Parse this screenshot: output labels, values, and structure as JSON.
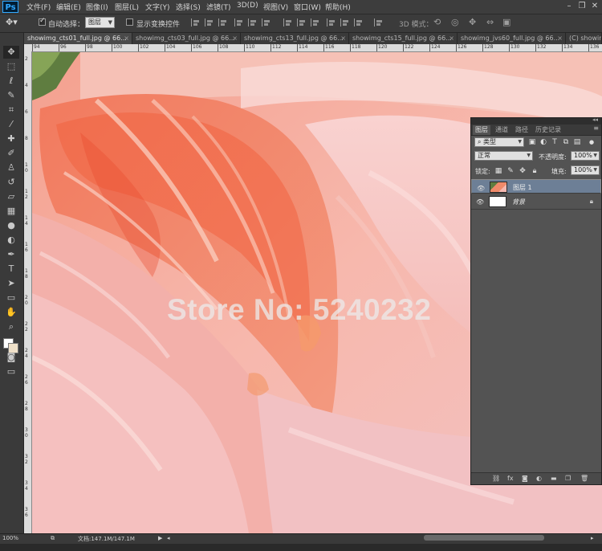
{
  "app": {
    "logo": "Ps"
  },
  "menu": [
    "文件(F)",
    "编辑(E)",
    "图像(I)",
    "图层(L)",
    "文字(Y)",
    "选择(S)",
    "滤镜(T)",
    "3D(D)",
    "视图(V)",
    "窗口(W)",
    "帮助(H)"
  ],
  "options": {
    "auto_select_label": "自动选择：",
    "auto_select_value": "图层",
    "show_transform_label": "显示变换控件",
    "mode_3d_label": "3D 模式："
  },
  "tabs": [
    "showimg_cts01_full.jpg @ 66...",
    "showimg_cts03_full.jpg @ 66...",
    "showimg_cts13_full.jpg @ 66...",
    "showimg_cts15_full.jpg @ 66...",
    "showimg_jvs60_full.jpg @ 66...",
    "(C) showim"
  ],
  "ruler_top": [
    "94",
    "96",
    "98",
    "100",
    "102",
    "104",
    "106",
    "108",
    "110",
    "112",
    "114",
    "116",
    "118",
    "120",
    "122",
    "124",
    "126",
    "128",
    "130",
    "132",
    "134",
    "136"
  ],
  "ruler_left": [
    "2",
    "4",
    "6",
    "8",
    "1 0",
    "1 2",
    "1 4",
    "1 6",
    "1 8",
    "2 0",
    "2 2",
    "2 4",
    "2 6",
    "2 8",
    "3 0",
    "3 2",
    "3 4",
    "3 6"
  ],
  "watermark": "Store No: 5240232",
  "layers_panel": {
    "tabs": [
      "图层",
      "通道",
      "路径",
      "历史记录"
    ],
    "filter_label": "类型",
    "blend_mode": "正常",
    "opacity_label": "不透明度:",
    "opacity_value": "100%",
    "lock_label": "锁定:",
    "fill_label": "填充:",
    "fill_value": "100%",
    "layers": [
      {
        "name": "图层 1",
        "selected": true
      },
      {
        "name": "背景",
        "selected": false
      }
    ]
  },
  "status": {
    "zoom": "100%",
    "doc_info": "文档:147.1M/147.1M"
  },
  "colors": {
    "selection": "#6d7f96",
    "panel_bg": "#535353",
    "foreground_swatch": "#ffffff",
    "background_swatch": "#efe0c8"
  }
}
